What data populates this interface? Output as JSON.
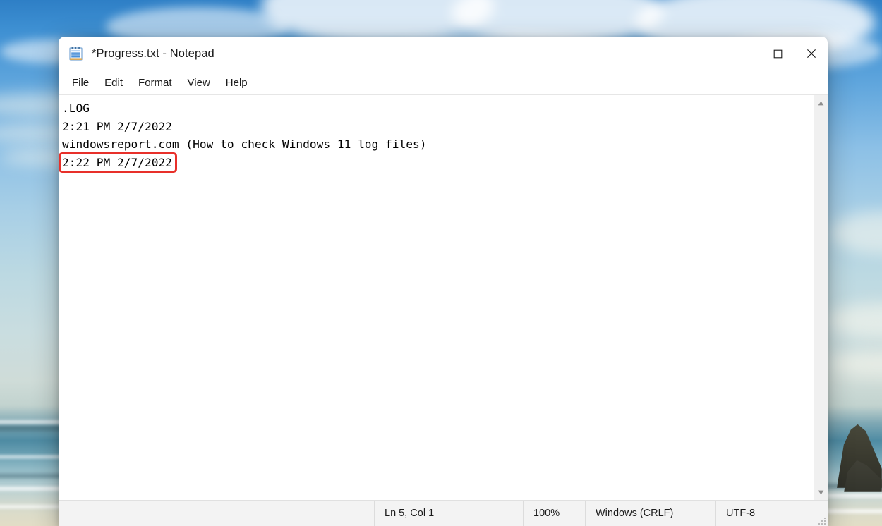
{
  "window": {
    "title": "*Progress.txt - Notepad",
    "icon": "notepad-icon",
    "controls": {
      "minimize": "minimize-icon",
      "maximize": "maximize-icon",
      "close": "close-icon"
    }
  },
  "menu": {
    "items": [
      {
        "label": "File"
      },
      {
        "label": "Edit"
      },
      {
        "label": "Format"
      },
      {
        "label": "View"
      },
      {
        "label": "Help"
      }
    ]
  },
  "editor": {
    "lines": [
      ".LOG",
      "2:21 PM 2/7/2022",
      "windowsreport.com (How to check Windows 11 log files)",
      "2:22 PM 2/7/2022",
      ""
    ],
    "annotation": {
      "target_line_index": 3,
      "target_text": "2:22 PM 2/7/2022",
      "color": "#e8302a"
    }
  },
  "scrollbar": {
    "up_arrow": "scroll-up-arrow-icon",
    "down_arrow": "scroll-down-arrow-icon"
  },
  "status_bar": {
    "position": "Ln 5, Col 1",
    "zoom": "100%",
    "line_ending": "Windows (CRLF)",
    "encoding": "UTF-8"
  }
}
